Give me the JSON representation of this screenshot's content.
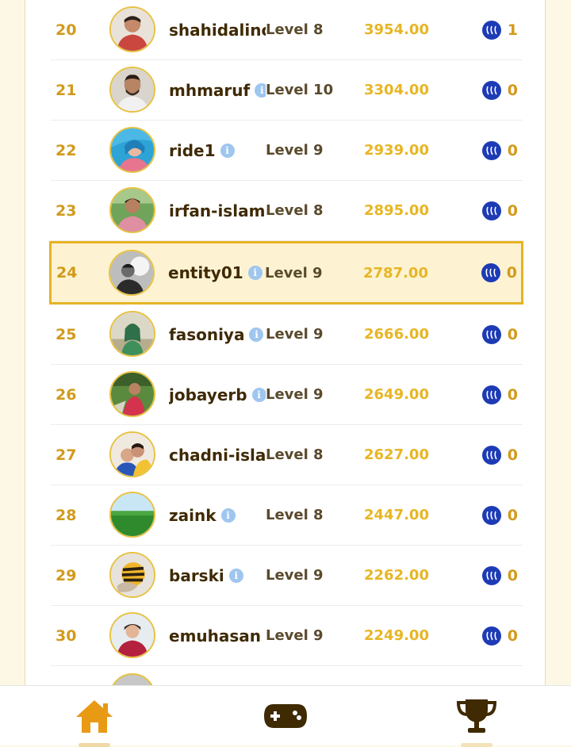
{
  "leaderboard": {
    "rows": [
      {
        "rank": "20",
        "username": "shahidalinc",
        "level": "Level 8",
        "points": "3954.00",
        "reward": "1",
        "avatar": "avatar-man-red-shirt"
      },
      {
        "rank": "21",
        "username": "mhmaruf",
        "level": "Level 10",
        "points": "3304.00",
        "reward": "0",
        "avatar": "avatar-man-beard"
      },
      {
        "rank": "22",
        "username": "ride1",
        "level": "Level 9",
        "points": "2939.00",
        "reward": "0",
        "avatar": "avatar-woman-blue"
      },
      {
        "rank": "23",
        "username": "irfan-islam",
        "level": "Level 8",
        "points": "2895.00",
        "reward": "0",
        "avatar": "avatar-man-outdoor"
      },
      {
        "rank": "24",
        "username": "entity01",
        "level": "Level 9",
        "points": "2787.00",
        "reward": "0",
        "avatar": "avatar-bw-photo",
        "highlight": true
      },
      {
        "rank": "25",
        "username": "fasoniya",
        "level": "Level 9",
        "points": "2666.00",
        "reward": "0",
        "avatar": "avatar-woman-hijab"
      },
      {
        "rank": "26",
        "username": "jobayerb",
        "level": "Level 9",
        "points": "2649.00",
        "reward": "0",
        "avatar": "avatar-person-grass"
      },
      {
        "rank": "27",
        "username": "chadni-isla",
        "level": "Level 8",
        "points": "2627.00",
        "reward": "0",
        "avatar": "avatar-couple"
      },
      {
        "rank": "28",
        "username": "zaink",
        "level": "Level 8",
        "points": "2447.00",
        "reward": "0",
        "avatar": "avatar-green-field"
      },
      {
        "rank": "29",
        "username": "barski",
        "level": "Level 9",
        "points": "2262.00",
        "reward": "0",
        "avatar": "avatar-bee-ball"
      },
      {
        "rank": "30",
        "username": "emuhasan",
        "level": "Level 9",
        "points": "2249.00",
        "reward": "0",
        "avatar": "avatar-woman-snow"
      }
    ]
  },
  "nav": {
    "items": [
      {
        "name": "home",
        "icon": "home-icon",
        "active": true
      },
      {
        "name": "games",
        "icon": "gamepad-icon",
        "active": false
      },
      {
        "name": "leaderboard",
        "icon": "trophy-icon",
        "active": false
      }
    ]
  },
  "colors": {
    "rank": "#d29a1c",
    "points": "#e7b624",
    "username": "#3f2a04",
    "highlight_border": "#e6b325",
    "highlight_bg": "#fdf3d2",
    "steem_coin": "#1d3bb5",
    "nav_active": "#e89a14",
    "nav_inactive": "#3f2a04"
  }
}
